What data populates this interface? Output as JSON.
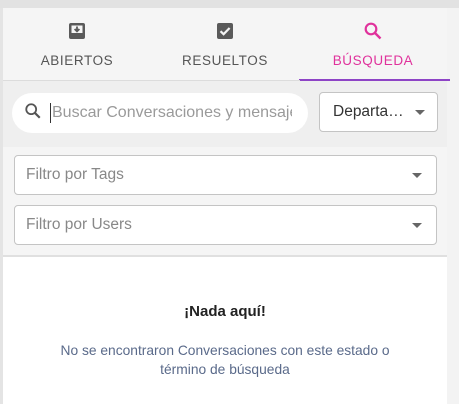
{
  "tabs": [
    {
      "label": "ABIERTOS",
      "icon": "inbox-arrow-icon",
      "active": false
    },
    {
      "label": "RESUELTOS",
      "icon": "checkbox-checked-icon",
      "active": false
    },
    {
      "label": "BÚSQUEDA",
      "icon": "search-icon",
      "active": true
    }
  ],
  "search": {
    "placeholder": "Buscar Conversaciones y mensajes",
    "value": ""
  },
  "department": {
    "label": "Departamento"
  },
  "filters": {
    "tags_placeholder": "Filtro por Tags",
    "users_placeholder": "Filtro por Users"
  },
  "empty_state": {
    "title": "¡Nada aquí!",
    "message": "No se encontraron Conversaciones con este estado o término de búsqueda"
  },
  "colors": {
    "active_tab_text": "#e0329c",
    "active_tab_underline": "#8e44c6",
    "message_text": "#5a6a8a"
  }
}
